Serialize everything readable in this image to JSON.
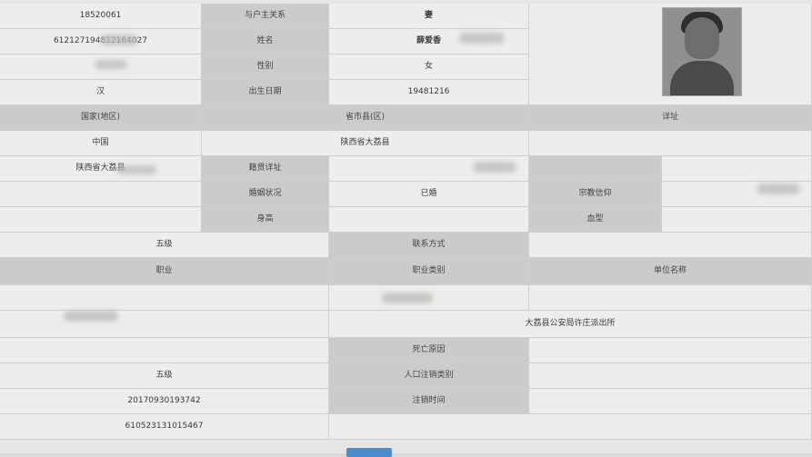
{
  "icons": {
    "photo": "portrait-photo-icon"
  },
  "colors": {
    "label_bg": "#cbcbc9",
    "value_bg": "#ededeb",
    "button": "#4a8ccf"
  },
  "row1": {
    "id": "18520061",
    "relation_label": "与户主关系",
    "relation_value": "妻"
  },
  "row2": {
    "id_number": "612127194812164027",
    "name_label": "姓名",
    "name_value": "薛爱香"
  },
  "row3": {
    "gender_label": "性别",
    "gender_value": "女"
  },
  "row4": {
    "ethnicity": "汉",
    "birth_label": "出生日期",
    "birth_value": "19481216"
  },
  "address_header": {
    "country_label": "国家(地区)",
    "province_label": "省市县(区)",
    "detail_label": "详址"
  },
  "address_values": {
    "country": "中国",
    "province": "陕西省大荔县"
  },
  "native": {
    "place": "陕西省大荔县",
    "native_label": "籍贯详址"
  },
  "marital": {
    "label": "婚姻状况",
    "value": "已婚",
    "religion_label": "宗教信仰"
  },
  "physical": {
    "height_label": "身高",
    "blood_label": "血型"
  },
  "contact": {
    "education": "五级",
    "contact_label": "联系方式"
  },
  "job_header": {
    "occupation_label": "职业",
    "job_type_label": "职业类别",
    "employer_label": "单位名称"
  },
  "police": {
    "station": "大荔县公安局许庄派出所"
  },
  "death": {
    "reason_label": "死亡原因"
  },
  "cancel": {
    "level": "五级",
    "category_label": "人口注销类别"
  },
  "record": {
    "number": "20170930193742",
    "time_label": "注销时间"
  },
  "code": {
    "number": "610523131015467"
  }
}
